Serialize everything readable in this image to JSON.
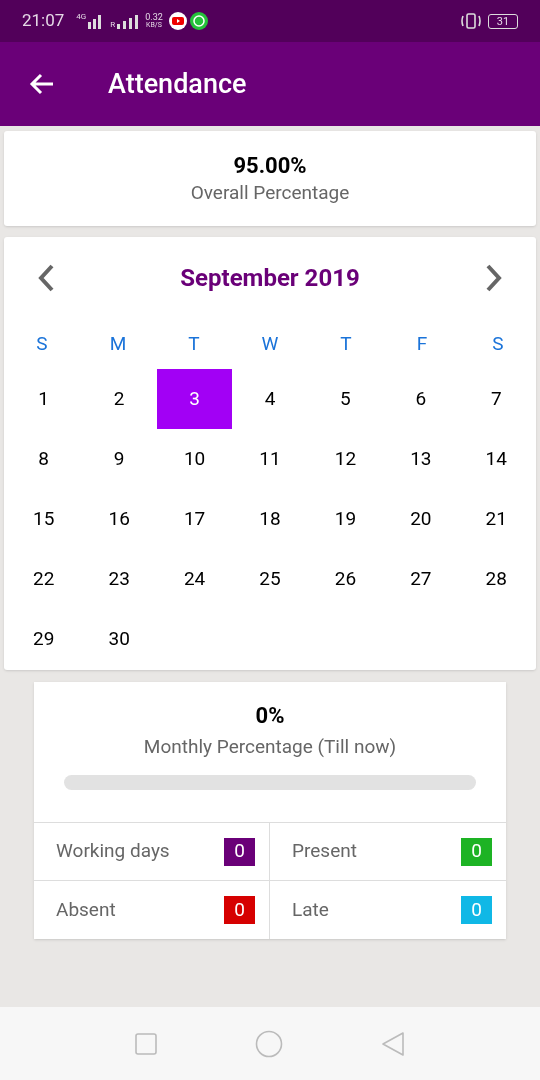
{
  "status_bar": {
    "time": "21:07",
    "network": "4G",
    "roaming": "R",
    "speed": "0.32",
    "speed_unit": "KB/S",
    "battery": "31"
  },
  "app_bar": {
    "title": "Attendance"
  },
  "overall": {
    "value": "95.00%",
    "label": "Overall Percentage"
  },
  "calendar": {
    "month": "September 2019",
    "weekdays": [
      "S",
      "M",
      "T",
      "W",
      "T",
      "F",
      "S"
    ],
    "days": [
      {
        "label": "1",
        "selected": false
      },
      {
        "label": "2",
        "selected": false
      },
      {
        "label": "3",
        "selected": true
      },
      {
        "label": "4",
        "selected": false
      },
      {
        "label": "5",
        "selected": false
      },
      {
        "label": "6",
        "selected": false
      },
      {
        "label": "7",
        "selected": false
      },
      {
        "label": "8",
        "selected": false
      },
      {
        "label": "9",
        "selected": false
      },
      {
        "label": "10",
        "selected": false
      },
      {
        "label": "11",
        "selected": false
      },
      {
        "label": "12",
        "selected": false
      },
      {
        "label": "13",
        "selected": false
      },
      {
        "label": "14",
        "selected": false
      },
      {
        "label": "15",
        "selected": false
      },
      {
        "label": "16",
        "selected": false
      },
      {
        "label": "17",
        "selected": false
      },
      {
        "label": "18",
        "selected": false
      },
      {
        "label": "19",
        "selected": false
      },
      {
        "label": "20",
        "selected": false
      },
      {
        "label": "21",
        "selected": false
      },
      {
        "label": "22",
        "selected": false
      },
      {
        "label": "23",
        "selected": false
      },
      {
        "label": "24",
        "selected": false
      },
      {
        "label": "25",
        "selected": false
      },
      {
        "label": "26",
        "selected": false
      },
      {
        "label": "27",
        "selected": false
      },
      {
        "label": "28",
        "selected": false
      },
      {
        "label": "29",
        "selected": false
      },
      {
        "label": "30",
        "selected": false
      }
    ]
  },
  "monthly": {
    "value": "0%",
    "label": "Monthly Percentage (Till now)",
    "level": 0,
    "stats": [
      {
        "label": "Working days",
        "count": "0",
        "color": "#6a0078"
      },
      {
        "label": "Present",
        "count": "0",
        "color": "#1db324"
      },
      {
        "label": "Absent",
        "count": "0",
        "color": "#d60000"
      },
      {
        "label": "Late",
        "count": "0",
        "color": "#10b8e6"
      }
    ]
  }
}
